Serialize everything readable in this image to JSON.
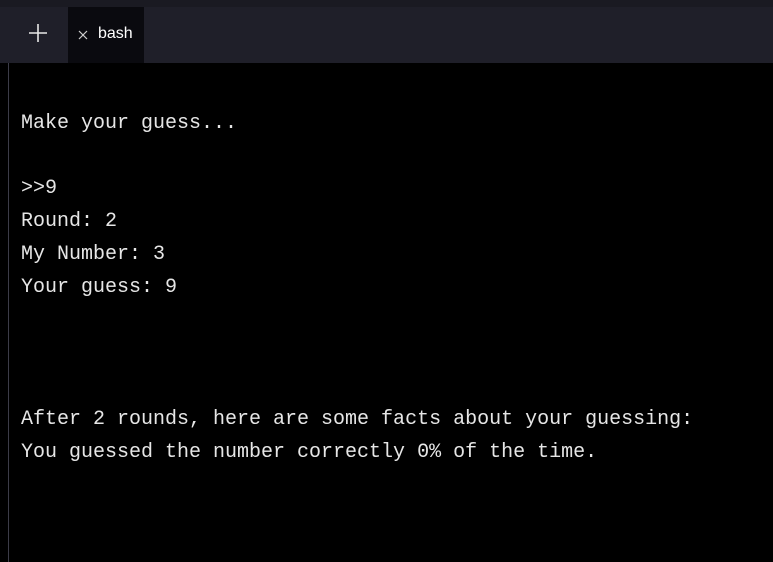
{
  "tabbar": {
    "new_tab_icon": "plus-icon",
    "tabs": [
      {
        "label": "bash",
        "close_icon": "close-icon",
        "active": true
      }
    ]
  },
  "terminal": {
    "lines": [
      "Make your guess...",
      ">>9",
      "Round: 2",
      "My Number: 3",
      "Your guess: 9",
      "After 2 rounds, here are some facts about your guessing:",
      "You guessed the number correctly 0% of the time."
    ]
  },
  "colors": {
    "background": "#000000",
    "tabbar": "#1f1f29",
    "active_tab": "#0a0a0f",
    "text": "#e6e6e6"
  }
}
